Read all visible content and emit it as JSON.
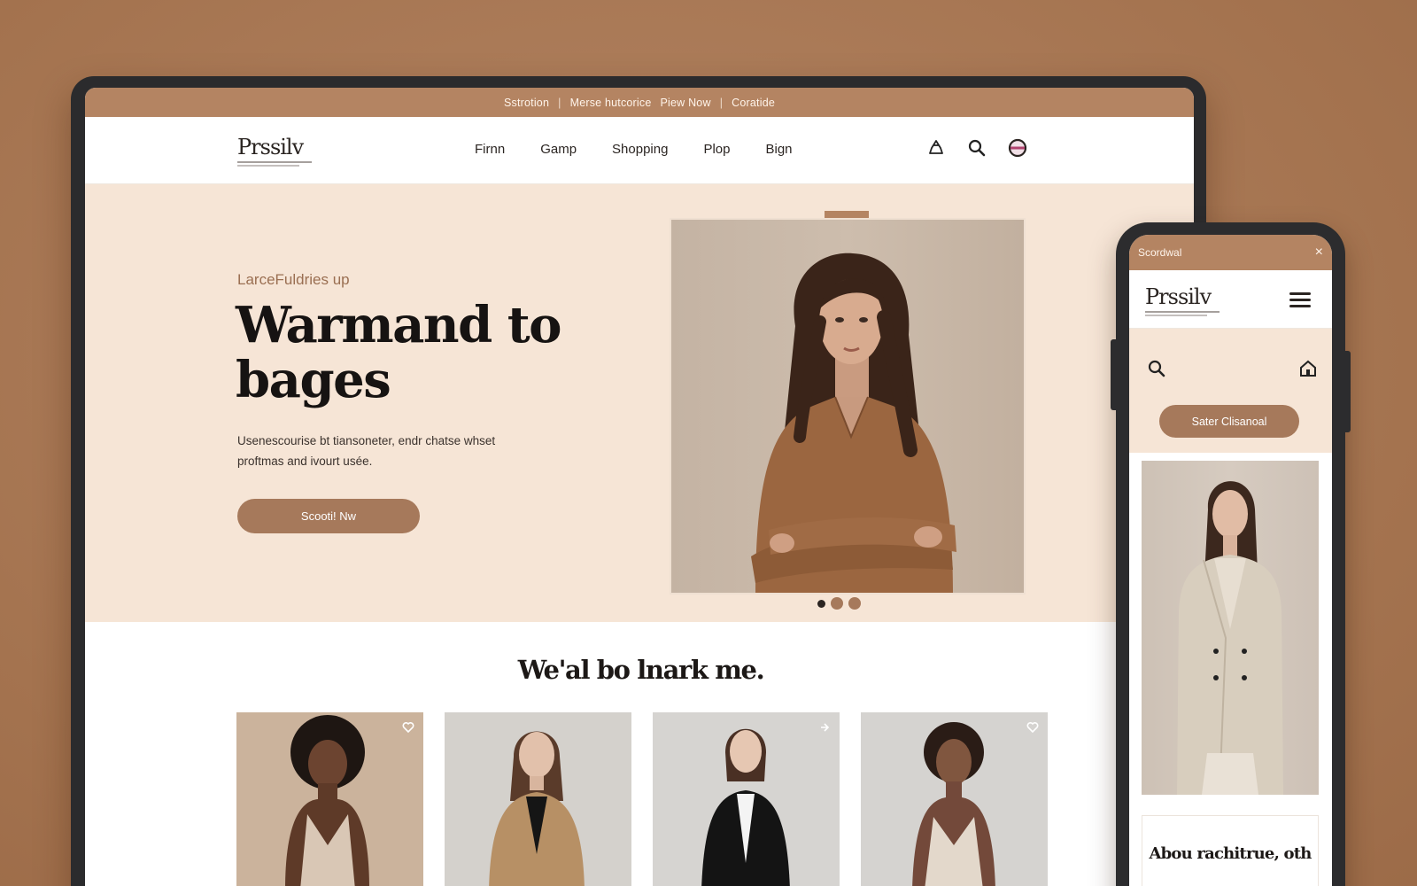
{
  "desktop": {
    "topbar": {
      "items": [
        "Sstrotion",
        "Merse hutcorice",
        "Piew Now",
        "Coratide"
      ]
    },
    "logo": {
      "text": "Prssilv"
    },
    "nav": {
      "items": [
        "Firnn",
        "Gamp",
        "Shopping",
        "Plop",
        "Bign"
      ],
      "icons": [
        "recycle-icon",
        "search-icon",
        "profile-icon"
      ]
    },
    "hero": {
      "eyebrow": "LarceFuldries up",
      "headline": "Warmand to bages",
      "description": "Usenescourise bt tiansoneter, endr chatse whset proftmas and ivourt usée.",
      "button_label": "Scooti! Nw",
      "carousel": {
        "count": 3,
        "active": 1
      }
    },
    "section_title": "We'al bo lnark me.",
    "products": [
      {
        "icon": "heart-icon"
      },
      {
        "icon": ""
      },
      {
        "icon": "arrow-icon"
      },
      {
        "icon": "heart-icon"
      }
    ]
  },
  "mobile": {
    "topbar": {
      "title": "Scordwal",
      "close": "×"
    },
    "logo": {
      "text": "Prssilv"
    },
    "button_label": "Sater Clisanoal",
    "card_title": "Abou rachitrue, oth"
  },
  "colors": {
    "background": "#a9795a",
    "accent": "#b48462",
    "button": "#a6795b",
    "hero_bg": "#f6e5d6",
    "text_dark": "#161312"
  }
}
